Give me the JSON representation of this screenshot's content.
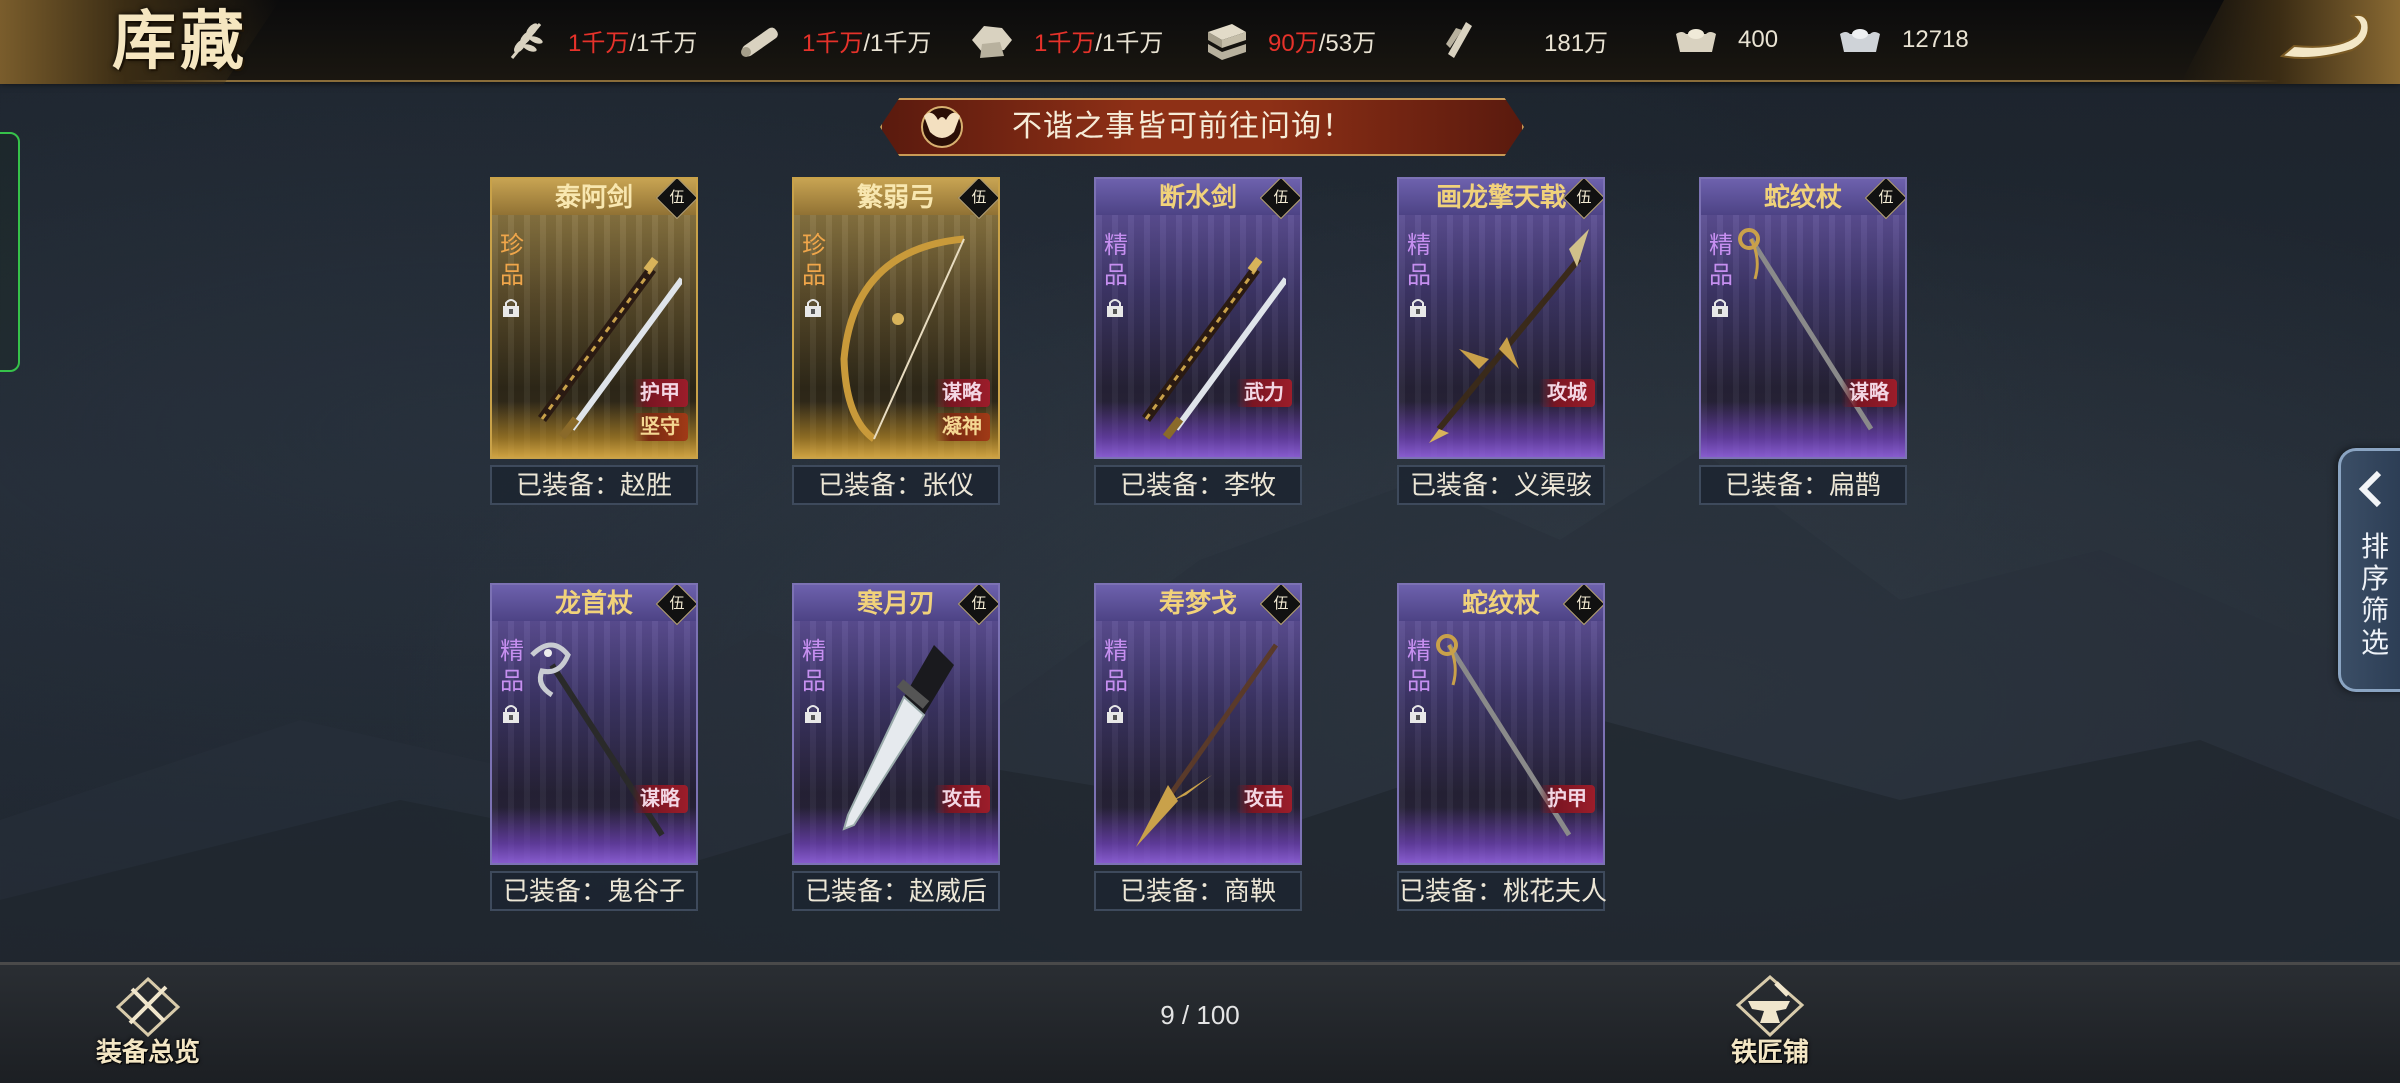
{
  "header": {
    "title": "库藏",
    "resources": [
      {
        "icon": "grain-icon",
        "current": "1千万",
        "max": "/1千万",
        "current_red": true
      },
      {
        "icon": "wood-icon",
        "current": "1千万",
        "max": "/1千万",
        "current_red": true
      },
      {
        "icon": "stone-icon",
        "current": "1千万",
        "max": "/1千万",
        "current_red": true
      },
      {
        "icon": "iron-icon",
        "current": "90万",
        "max": "/53万",
        "current_red": true
      },
      {
        "icon": "recruit-icon",
        "current": "181万",
        "max": "",
        "current_red": false
      },
      {
        "icon": "gold-ingot-icon",
        "current": "400",
        "max": "",
        "current_red": false
      },
      {
        "icon": "silver-ingot-icon",
        "current": "12718",
        "max": "",
        "current_red": false
      }
    ]
  },
  "banner": {
    "text": "不谐之事皆可前往问询！"
  },
  "filter_tab": {
    "label": "排序筛选"
  },
  "cards": [
    {
      "name": "泰阿剑",
      "rank": "伍",
      "quality": "珍品",
      "rarity": "gold",
      "weapon": "sword-pair",
      "tags": [
        "护甲",
        "坚守"
      ],
      "equipped": "已装备：赵胜"
    },
    {
      "name": "繁弱弓",
      "rank": "伍",
      "quality": "珍品",
      "rarity": "gold",
      "weapon": "bow",
      "tags": [
        "谋略",
        "凝神"
      ],
      "equipped": "已装备：张仪"
    },
    {
      "name": "断水剑",
      "rank": "伍",
      "quality": "精品",
      "rarity": "purple",
      "weapon": "sword-pair",
      "tags": [
        "武力"
      ],
      "equipped": "已装备：李牧"
    },
    {
      "name": "画龙擎天戟",
      "rank": "伍",
      "quality": "精品",
      "rarity": "purple",
      "weapon": "halberd",
      "tags": [
        "攻城"
      ],
      "equipped": "已装备：义渠骇"
    },
    {
      "name": "蛇纹杖",
      "rank": "伍",
      "quality": "精品",
      "rarity": "purple",
      "weapon": "staff",
      "tags": [
        "谋略"
      ],
      "equipped": "已装备：扁鹊"
    },
    {
      "name": "龙首杖",
      "rank": "伍",
      "quality": "精品",
      "rarity": "purple",
      "weapon": "dragon-staff",
      "tags": [
        "谋略"
      ],
      "equipped": "已装备：鬼谷子"
    },
    {
      "name": "寒月刃",
      "rank": "伍",
      "quality": "精品",
      "rarity": "purple",
      "weapon": "blade",
      "tags": [
        "攻击"
      ],
      "equipped": "已装备：赵威后"
    },
    {
      "name": "寿梦戈",
      "rank": "伍",
      "quality": "精品",
      "rarity": "purple",
      "weapon": "spear",
      "tags": [
        "攻击"
      ],
      "equipped": "已装备：商鞅"
    },
    {
      "name": "蛇纹杖",
      "rank": "伍",
      "quality": "精品",
      "rarity": "purple",
      "weapon": "staff",
      "tags": [
        "护甲"
      ],
      "equipped": "已装备：桃花夫人"
    }
  ],
  "footer": {
    "overview_label": "装备总览",
    "page_count": "9 / 100",
    "smithy_label": "铁匠铺"
  },
  "colors": {
    "accent_gold": "#c9a249",
    "accent_purple": "#7c72b4",
    "red_value": "#e6322a",
    "tag_red": "#9c1d2a"
  }
}
